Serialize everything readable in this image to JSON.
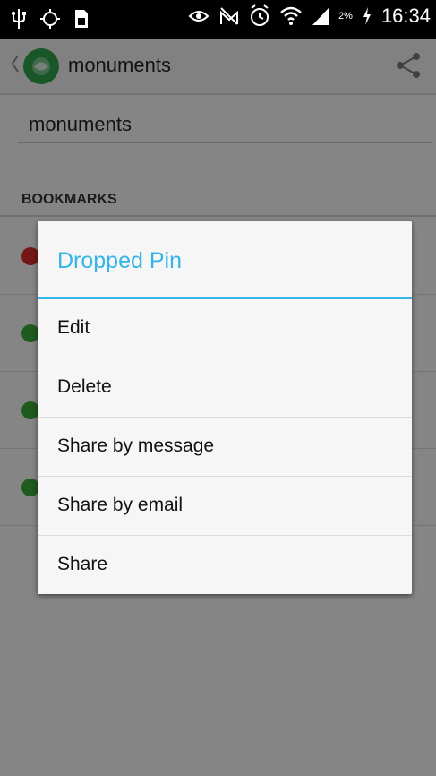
{
  "status_bar": {
    "time": "16:34",
    "battery_percent": "2%"
  },
  "action_bar": {
    "title": "monuments",
    "icons": [
      "back-chevron-icon",
      "app-logo-icon",
      "share-icon"
    ]
  },
  "search": {
    "value": "monuments"
  },
  "bookmarks": {
    "header": "BOOKMARKS",
    "rows": [
      {
        "color": "#d42a2a"
      },
      {
        "color": "#3aa53a"
      },
      {
        "color": "#3aa53a"
      },
      {
        "color": "#3aa53a"
      }
    ]
  },
  "dialog": {
    "title": "Dropped Pin",
    "items": [
      "Edit",
      "Delete",
      "Share by message",
      "Share by email",
      "Share"
    ]
  },
  "colors": {
    "accent": "#35b5e5",
    "logo": "#2e9e49"
  }
}
